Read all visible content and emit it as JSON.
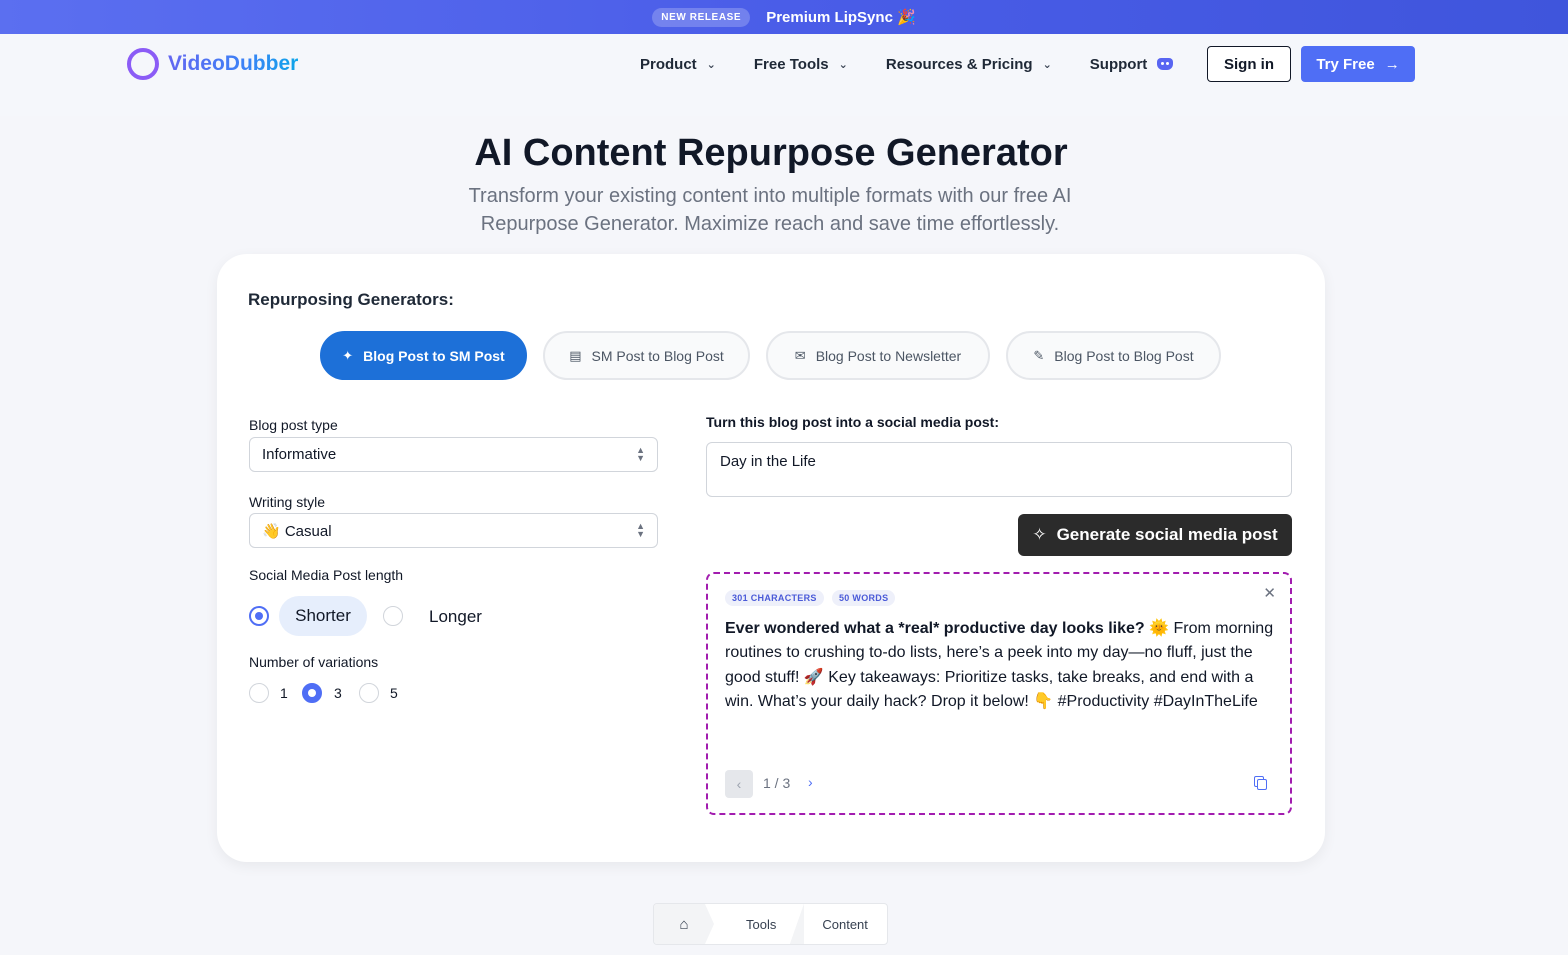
{
  "announcement": {
    "badge": "NEW RELEASE",
    "message": "Premium LipSync 🎉"
  },
  "brand": {
    "name": "VideoDubber"
  },
  "nav": {
    "items": [
      {
        "label": "Product"
      },
      {
        "label": "Free Tools"
      },
      {
        "label": "Resources & Pricing"
      },
      {
        "label": "Support"
      }
    ],
    "signin_label": "Sign in",
    "tryfree_label": "Try Free"
  },
  "hero": {
    "title": "AI Content Repurpose Generator",
    "subtitle": "Transform your existing content into multiple formats with our free AI Repurpose Generator. Maximize reach and save time effortlessly."
  },
  "card": {
    "heading": "Repurposing Generators:",
    "tabs": [
      {
        "label": "Blog Post to SM Post",
        "icon": "bird-icon",
        "active": true
      },
      {
        "label": "SM Post to Blog Post",
        "icon": "document-icon",
        "active": false
      },
      {
        "label": "Blog Post to Newsletter",
        "icon": "mail-icon",
        "active": false
      },
      {
        "label": "Blog Post to Blog Post",
        "icon": "pencil-icon",
        "active": false
      }
    ],
    "blog_type": {
      "label": "Blog post type",
      "value": "Informative"
    },
    "writing_style": {
      "label": "Writing style",
      "value": "👋 Casual"
    },
    "length": {
      "label": "Social Media Post length",
      "options": [
        "Shorter",
        "Longer"
      ],
      "selected": "Shorter"
    },
    "variations": {
      "label": "Number of variations",
      "options": [
        "1",
        "3",
        "5"
      ],
      "selected": "3"
    },
    "input": {
      "label": "Turn this blog post into a social media post:",
      "value": "Day in the Life"
    },
    "generate_label": "Generate social media post",
    "result": {
      "characters": "301 CHARACTERS",
      "words": "50 WORDS",
      "headline": "Ever wondered what a *real* productive day looks like? 🌞",
      "body": " From morning routines to crushing to-do lists, here’s a peek into my day—no fluff, just the good stuff! 🚀 Key takeaways: Prioritize tasks, take breaks, and end with a win. What’s your daily hack? Drop it below! 👇 #Productivity #DayInTheLife",
      "pager": "1 / 3"
    }
  },
  "breadcrumb": {
    "items": [
      "Tools",
      "Content"
    ]
  },
  "colors": {
    "accent": "#4f6ef5",
    "tab_active": "#1d70d8",
    "result_border": "#a21caf"
  }
}
